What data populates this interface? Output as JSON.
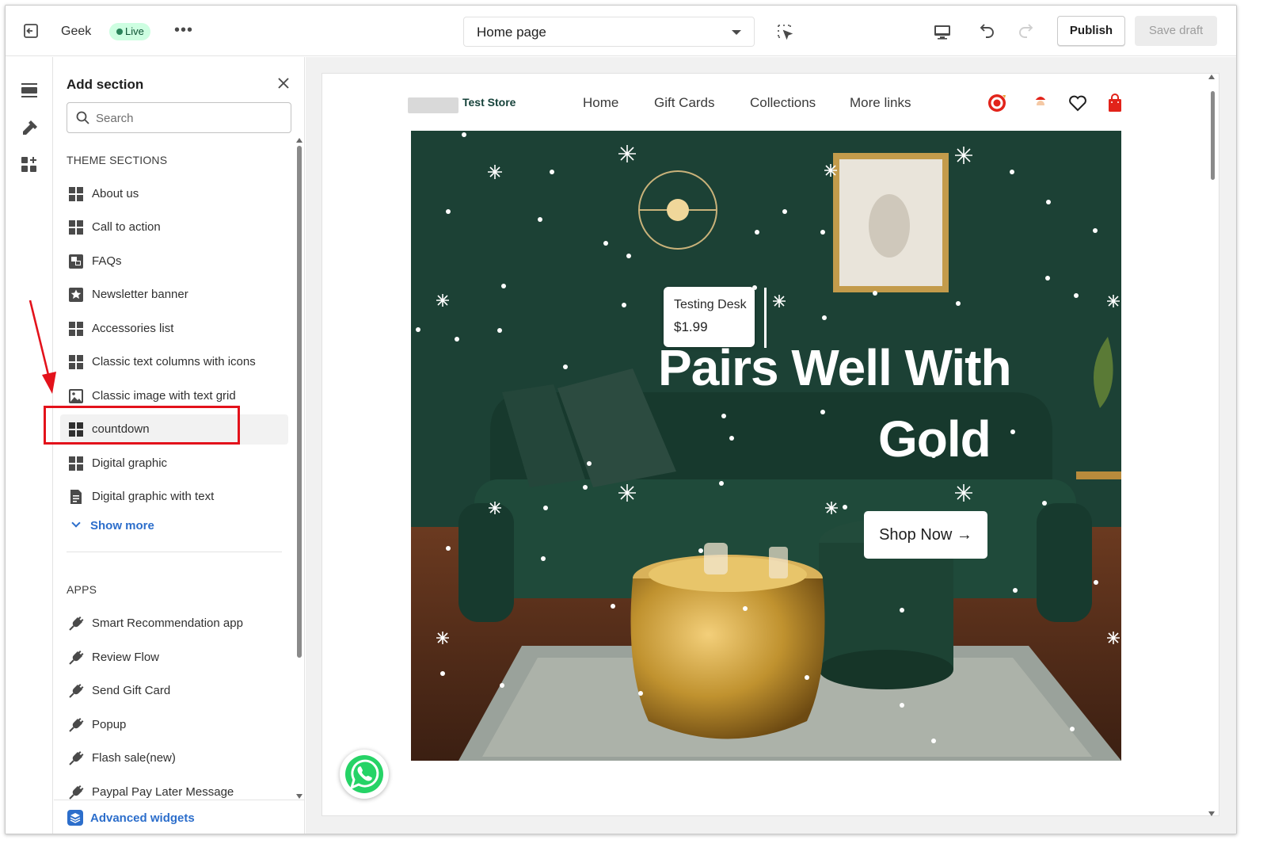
{
  "topbar": {
    "store_name": "Geek",
    "status_badge": "Live",
    "more_label": "•••",
    "page_select": "Home page",
    "publish_label": "Publish",
    "save_draft_label": "Save draft"
  },
  "rail": {
    "icons": [
      "sections-icon",
      "theme-settings-icon",
      "app-embeds-icon"
    ]
  },
  "panel": {
    "title": "Add section",
    "search_placeholder": "Search",
    "theme_sections_heading": "THEME SECTIONS",
    "theme_sections": [
      {
        "label": "About us",
        "icon": "grid-icon"
      },
      {
        "label": "Call to action",
        "icon": "grid-icon"
      },
      {
        "label": "FAQs",
        "icon": "faq-icon"
      },
      {
        "label": "Newsletter banner",
        "icon": "star-icon"
      },
      {
        "label": "Accessories list",
        "icon": "grid-icon"
      },
      {
        "label": "Classic text columns with icons",
        "icon": "grid-icon"
      },
      {
        "label": "Classic image with text grid",
        "icon": "image-icon"
      },
      {
        "label": "countdown",
        "icon": "grid-icon"
      },
      {
        "label": "Digital graphic",
        "icon": "grid-icon"
      },
      {
        "label": "Digital graphic with text",
        "icon": "document-icon"
      }
    ],
    "show_more": "Show more",
    "apps_heading": "APPS",
    "apps": [
      {
        "label": "Smart Recommendation app",
        "icon": "plug-icon"
      },
      {
        "label": "Review Flow",
        "icon": "plug-icon"
      },
      {
        "label": "Send Gift Card",
        "icon": "plug-icon"
      },
      {
        "label": "Popup",
        "icon": "plug-icon"
      },
      {
        "label": "Flash sale(new)",
        "icon": "plug-icon"
      },
      {
        "label": "Paypal Pay Later Message",
        "icon": "plug-icon"
      }
    ],
    "advanced_widgets": "Advanced widgets"
  },
  "preview": {
    "store_logo_text": "Test Store",
    "nav": [
      "Home",
      "Gift Cards",
      "Collections",
      "More links"
    ],
    "product_tag": {
      "name": "Testing Desk",
      "price": "$1.99"
    },
    "headline_line1": "Pairs Well With",
    "headline_line2": "Gold",
    "cta": "Shop Now →"
  },
  "colors": {
    "accent_link": "#2c6ecb",
    "live_badge_bg": "#cdfee1",
    "hero_wall": "#1c4135",
    "annotation_red": "#e3121b"
  }
}
